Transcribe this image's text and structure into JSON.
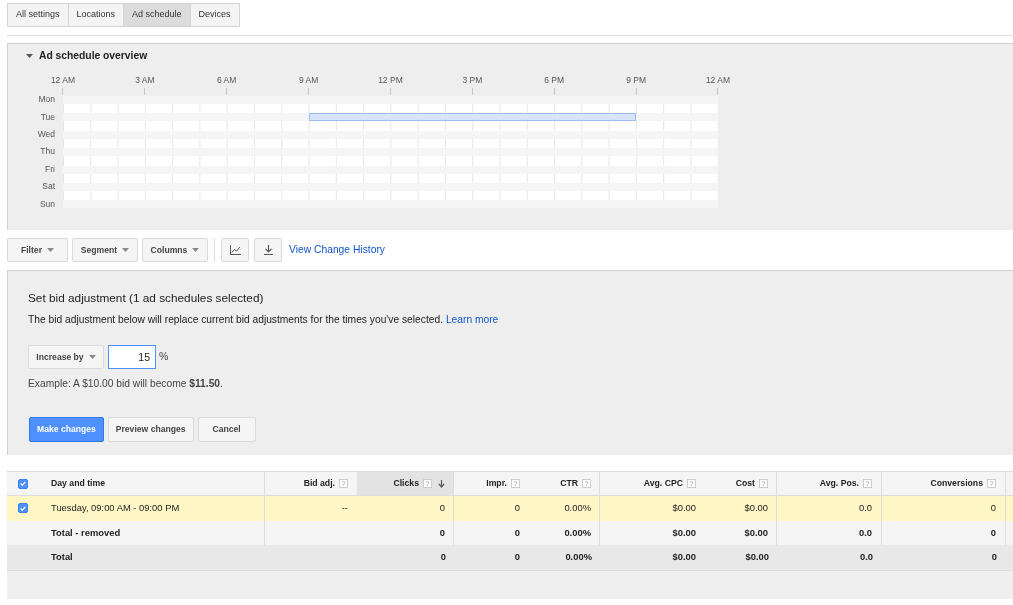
{
  "tabs": [
    {
      "label": "All settings",
      "selected": false
    },
    {
      "label": "Locations",
      "selected": false
    },
    {
      "label": "Ad schedule",
      "selected": true
    },
    {
      "label": "Devices",
      "selected": false
    }
  ],
  "overview": {
    "title": "Ad schedule overview",
    "expanded": true,
    "hour_labels": [
      "12 AM",
      "3 AM",
      "6 AM",
      "9 AM",
      "12 PM",
      "3 PM",
      "6 PM",
      "9 PM",
      "12 AM"
    ],
    "days": [
      {
        "label": "Mon",
        "hours": [
          false,
          false,
          false,
          false,
          false,
          false,
          false,
          false,
          false,
          false,
          false,
          false,
          false,
          false,
          false,
          false,
          false,
          false,
          false,
          false,
          false,
          false,
          false,
          false
        ]
      },
      {
        "label": "Tue",
        "hours": [
          false,
          false,
          false,
          false,
          false,
          false,
          false,
          false,
          false,
          true,
          true,
          true,
          true,
          true,
          true,
          true,
          true,
          true,
          true,
          true,
          true,
          false,
          false,
          false
        ]
      },
      {
        "label": "Wed",
        "hours": [
          false,
          false,
          false,
          false,
          false,
          false,
          false,
          false,
          false,
          false,
          false,
          false,
          false,
          false,
          false,
          false,
          false,
          false,
          false,
          false,
          false,
          false,
          false,
          false
        ]
      },
      {
        "label": "Thu",
        "hours": [
          false,
          false,
          false,
          false,
          false,
          false,
          false,
          false,
          false,
          false,
          false,
          false,
          false,
          false,
          false,
          false,
          false,
          false,
          false,
          false,
          false,
          false,
          false,
          false
        ]
      },
      {
        "label": "Fri",
        "hours": [
          false,
          false,
          false,
          false,
          false,
          false,
          false,
          false,
          false,
          false,
          false,
          false,
          false,
          false,
          false,
          false,
          false,
          false,
          false,
          false,
          false,
          false,
          false,
          false
        ]
      },
      {
        "label": "Sat",
        "hours": [
          false,
          false,
          false,
          false,
          false,
          false,
          false,
          false,
          false,
          false,
          false,
          false,
          false,
          false,
          false,
          false,
          false,
          false,
          false,
          false,
          false,
          false,
          false,
          false
        ]
      },
      {
        "label": "Sun",
        "hours": [
          false,
          false,
          false,
          false,
          false,
          false,
          false,
          false,
          false,
          false,
          false,
          false,
          false,
          false,
          false,
          false,
          false,
          false,
          false,
          false,
          false,
          false,
          false,
          false
        ]
      }
    ]
  },
  "toolbar": {
    "dropdowns": [
      {
        "label": "Filter"
      },
      {
        "label": "Segment"
      },
      {
        "label": "Columns"
      }
    ],
    "icon_buttons": [
      {
        "kind": "chart"
      },
      {
        "kind": "download"
      }
    ],
    "link": "View Change History"
  },
  "bid_adjustment": {
    "title": "Set bid adjustment (1 ad schedules selected)",
    "description": "The bid adjustment below will replace current bid adjustments for the times you've selected.",
    "learn_more": "Learn more",
    "mode": "Increase by",
    "value": "15",
    "focused": true,
    "unit": "%",
    "example": "Example: A $10.00 bid will become **$11.50**.",
    "buttons": [
      {
        "label": "Make changes",
        "kind": "primary"
      },
      {
        "label": "Preview changes",
        "kind": "secondary"
      },
      {
        "label": "Cancel",
        "kind": "secondary"
      }
    ]
  },
  "table": {
    "select_all": {
      "checked": true
    },
    "columns": [
      {
        "label": "Day and time",
        "sorted": false
      },
      {
        "label": "Bid adj.",
        "help": "?",
        "sorted": false
      },
      {
        "label": "Clicks",
        "help": "?",
        "sorted": true
      },
      {
        "label": "Impr.",
        "help": "?",
        "sorted": false
      },
      {
        "label": "CTR",
        "help": "?",
        "sorted": false
      },
      {
        "label": "Avg. CPC",
        "help": "?",
        "sorted": false
      },
      {
        "label": "Cost",
        "help": "?",
        "sorted": false
      },
      {
        "label": "Avg. Pos.",
        "help": "?",
        "sorted": false
      },
      {
        "label": "Conversions",
        "help": "?",
        "sorted": false
      }
    ],
    "rows": [
      {
        "checked": true,
        "cells": [
          "Tuesday, 09:00 AM - 09:00 PM",
          "--",
          "0",
          "0",
          "0.00%",
          "$0.00",
          "$0.00",
          "0.0",
          "0"
        ]
      }
    ],
    "totals": [
      {
        "kind": "subtotal",
        "cells": [
          "Total - removed",
          null,
          "0",
          "0",
          "0.00%",
          "$0.00",
          "$0.00",
          "0.0",
          "0"
        ]
      },
      {
        "kind": "total",
        "cells": [
          "Total",
          null,
          "0",
          "0",
          "0.00%",
          "$0.00",
          "$0.00",
          "0.0",
          "0"
        ]
      }
    ]
  }
}
